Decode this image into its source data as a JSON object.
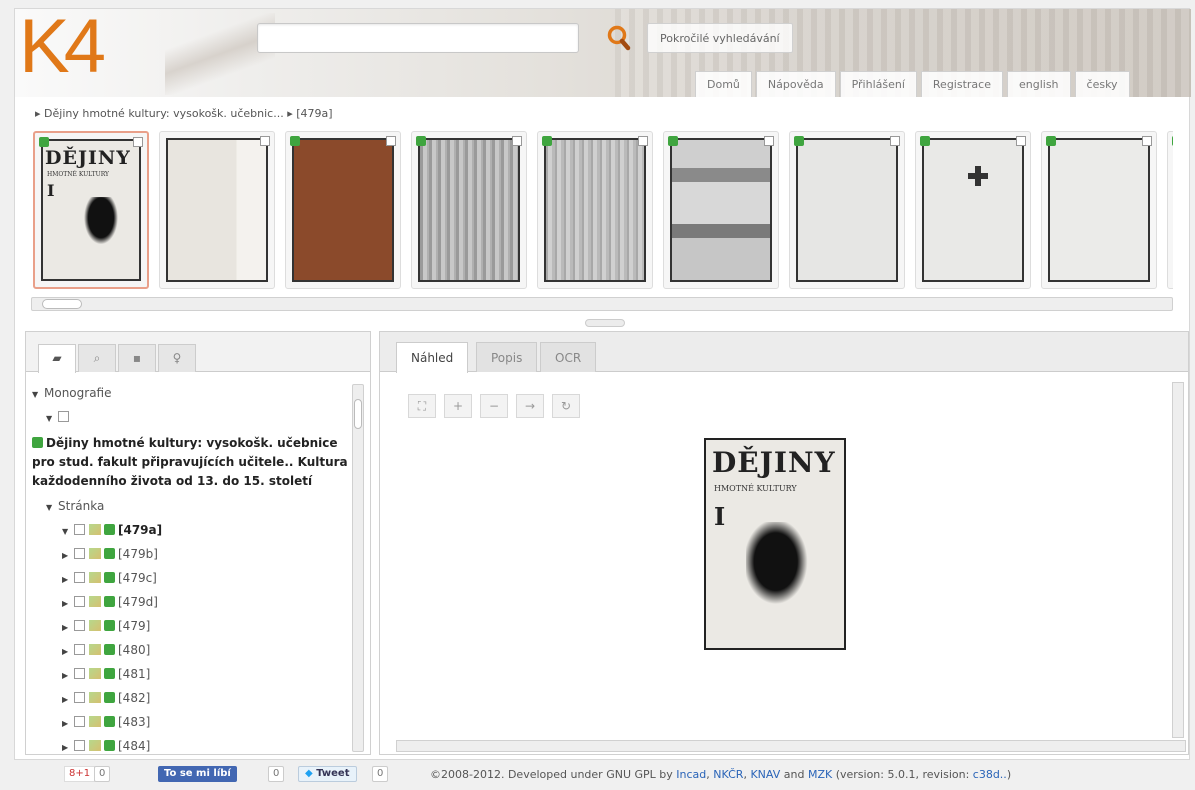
{
  "header": {
    "logo": "K4",
    "search_placeholder": "",
    "advanced_search": "Pokročilé vyhledávání",
    "nav": [
      "Domů",
      "Nápověda",
      "Přihlášení",
      "Registrace",
      "english",
      "česky"
    ]
  },
  "breadcrumb": {
    "items": [
      "Dějiny hmotné kultury: vysokošk. učebnic...",
      "[479a]"
    ]
  },
  "thumbnails": {
    "cover": {
      "title": "DĚJINY",
      "subtitle": "HMOTNÉ KULTURY",
      "volume": "I"
    }
  },
  "left_panel": {
    "tabs": [
      "folder-icon",
      "search-icon",
      "list-icon",
      "bulb-icon"
    ],
    "tree": {
      "root": "Monografie",
      "title": "Dějiny hmotné kultury: vysokošk. učebnice pro stud. fakult připravujících učitele.. Kultura každodenního života od 13. do 15. století",
      "group": "Stránka",
      "pages": [
        "[479a]",
        "[479b]",
        "[479c]",
        "[479d]",
        "[479]",
        "[480]",
        "[481]",
        "[482]",
        "[483]",
        "[484]"
      ]
    }
  },
  "right_panel": {
    "tabs": [
      "Náhled",
      "Popis",
      "OCR"
    ],
    "controls": [
      "fit-icon",
      "zoom-in-icon",
      "zoom-out-icon",
      "next-icon",
      "rotate-icon"
    ],
    "preview": {
      "title": "DĚJINY",
      "subtitle": "HMOTNÉ KULTURY",
      "volume": "I"
    }
  },
  "footer": {
    "gplus_label": "8+1",
    "gplus_count": "0",
    "fb_label": "To se mi líbí",
    "fb_count": "0",
    "tweet_label": "Tweet",
    "tweet_count": "0",
    "copyright_pre": "©2008-2012. Developed under GNU GPL by",
    "link_incad": "Incad",
    "link_nkcr": "NKČR",
    "link_knav": "KNAV",
    "and": "and",
    "link_mzk": "MZK",
    "version_pre": "(version: 5.0.1, revision:",
    "revision": "c38d..",
    "version_post": ")"
  },
  "colors": {
    "accent": "#e07818",
    "badge": "#3fa53f",
    "link": "#2a64b8",
    "selected_border": "#e9a08a"
  }
}
